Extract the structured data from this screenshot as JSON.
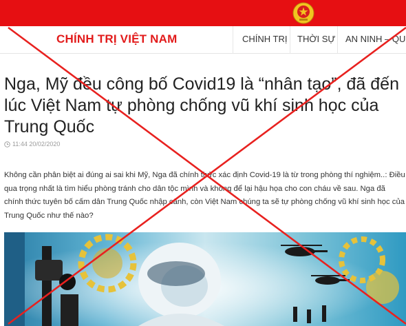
{
  "header": {
    "site_name": "CHÍNH TRỊ VIỆT NAM",
    "nav": [
      "CHÍNH TRỊ",
      "THỜI SỰ",
      "AN NINH – QUỐC"
    ]
  },
  "article": {
    "title": "Nga, Mỹ đều công bố Covid19 là “nhân tạo”, đã đến lúc Việt Nam tự phòng chống vũ khí sinh học của Trung Quốc",
    "timestamp": "11:44 20/02/2020",
    "lead": "Không cần phân biệt ai đúng ai sai khi Mỹ, Nga đã chính thức xác định Covid-19 là từ trong phòng thí nghiệm..: Điều qua trọng nhất là tìm hiểu phòng tránh cho dân tộc mình và không để lại hậu họa cho con cháu về sau. Nga đã chính thức tuyên bố cấm dân Trung Quốc nhập cảnh, còn Việt Nam chúng ta sẽ tự phòng chống vũ khí sinh học của Trung Quốc như thế nào?"
  },
  "colors": {
    "brand_red": "#e60f12",
    "cross_red": "#e8211f",
    "emblem_gold": "#f2c420"
  },
  "icons": {
    "emblem": "national-emblem-icon",
    "clock": "clock-icon"
  }
}
